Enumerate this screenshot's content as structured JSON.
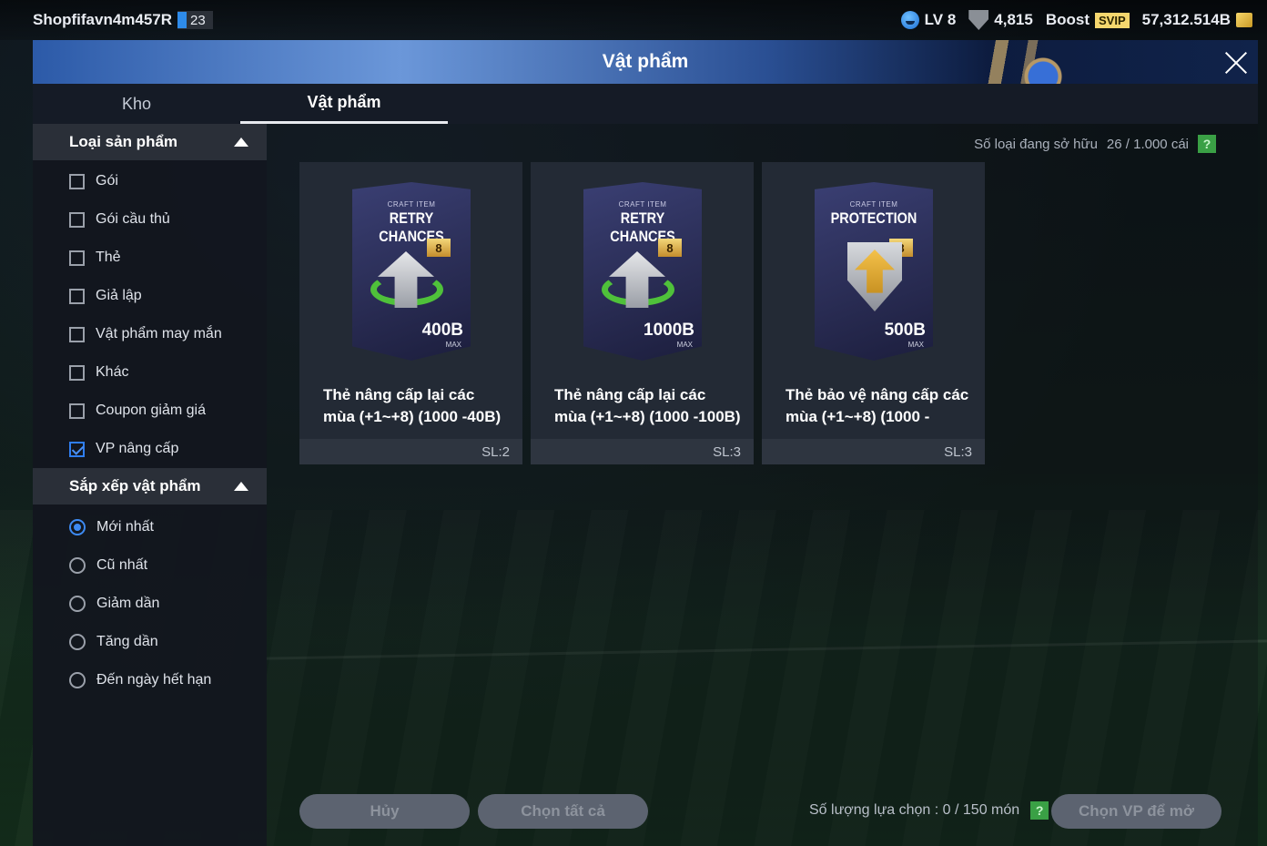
{
  "top": {
    "username": "Shopfifavn4m457R",
    "user_badge": "23",
    "level": "LV 8",
    "points": "4,815",
    "boost_label": "Boost",
    "svip_label": "SVIP",
    "bp": "57,312.514B"
  },
  "banner": {
    "title": "Vật phẩm"
  },
  "tabs": [
    "Kho",
    "Vật phẩm"
  ],
  "filters": {
    "section_title": "Loại sản phẩm",
    "items": [
      {
        "label": "Gói",
        "checked": false
      },
      {
        "label": "Gói cầu thủ",
        "checked": false
      },
      {
        "label": "Thẻ",
        "checked": false
      },
      {
        "label": "Giả lập",
        "checked": false
      },
      {
        "label": "Vật phẩm may mắn",
        "checked": false
      },
      {
        "label": "Khác",
        "checked": false
      },
      {
        "label": "Coupon giảm giá",
        "checked": false
      },
      {
        "label": "VP nâng cấp",
        "checked": true
      }
    ]
  },
  "sort": {
    "section_title": "Sắp xếp vật phẩm",
    "items": [
      {
        "label": "Mới nhất",
        "selected": true
      },
      {
        "label": "Cũ nhất",
        "selected": false
      },
      {
        "label": "Giảm dần",
        "selected": false
      },
      {
        "label": "Tăng dần",
        "selected": false
      },
      {
        "label": "Đến ngày hết hạn",
        "selected": false
      }
    ]
  },
  "main": {
    "owned_label": "Số loại đang sở hữu",
    "owned_value": "26 / 1.000 cái",
    "help": "?",
    "cards": [
      {
        "craft": "CRAFT ITEM",
        "kind": "RETRY CHANCES",
        "tier": "8",
        "value": "400B",
        "max": "MAX",
        "name": "Thẻ nâng cấp lại các mùa (+1~+8) (1000 -40B)",
        "qty": "SL:2",
        "icon": "retry"
      },
      {
        "craft": "CRAFT ITEM",
        "kind": "RETRY CHANCES",
        "tier": "8",
        "value": "1000B",
        "max": "MAX",
        "name": "Thẻ nâng cấp lại các mùa (+1~+8) (1000 -100B)",
        "qty": "SL:3",
        "icon": "retry"
      },
      {
        "craft": "CRAFT ITEM",
        "kind": "PROTECTION",
        "tier": "8",
        "value": "500B",
        "max": "MAX",
        "name": "Thẻ bảo vệ nâng cấp các mùa (+1~+8) (1000 -",
        "qty": "SL:3",
        "icon": "protection"
      }
    ]
  },
  "bottom": {
    "cancel": "Hủy",
    "select_all": "Chọn tất cả",
    "select_count": "Số lượng lựa chọn : 0 / 150 món",
    "help": "?",
    "open": "Chọn VP để mở"
  }
}
